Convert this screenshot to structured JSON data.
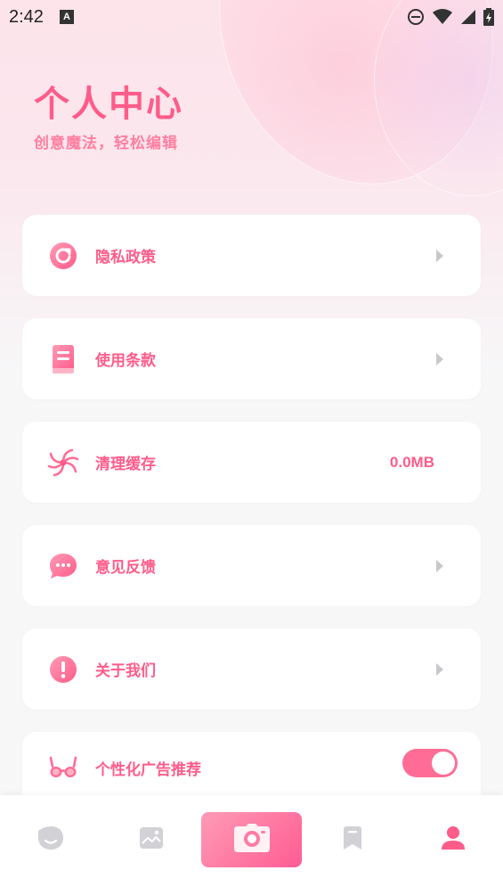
{
  "statusbar": {
    "time": "2:42",
    "notification_icon_letter": "A"
  },
  "header": {
    "title": "个人中心",
    "subtitle": "创意魔法，轻松编辑"
  },
  "menu": {
    "items": [
      {
        "label": "隐私政策",
        "icon": "refresh-circle-icon"
      },
      {
        "label": "使用条款",
        "icon": "book-icon"
      },
      {
        "label": "清理缓存",
        "icon": "swirl-icon",
        "value": "0.0MB"
      },
      {
        "label": "意见反馈",
        "icon": "chat-bubble-icon"
      },
      {
        "label": "关于我们",
        "icon": "exclamation-circle-icon"
      },
      {
        "label": "个性化广告推荐",
        "icon": "glasses-icon",
        "toggle_on": true
      }
    ]
  },
  "tabbar": {
    "tabs": [
      {
        "icon": "face-icon"
      },
      {
        "icon": "image-icon"
      },
      {
        "icon": "camera-icon",
        "active_center": true
      },
      {
        "icon": "bookmark-icon"
      },
      {
        "icon": "user-icon",
        "active": true
      }
    ]
  },
  "colors": {
    "accent": "#ff5c8a",
    "accent_light": "#ff7fa1",
    "arrow": "#c8c8cc",
    "tab_inactive": "#cfcfd4"
  }
}
